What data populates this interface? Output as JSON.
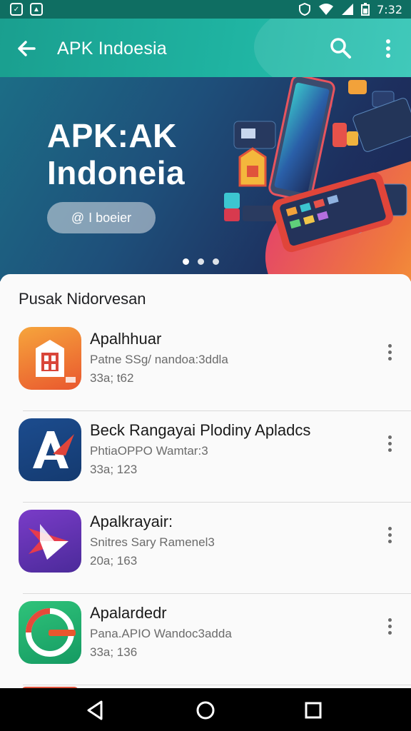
{
  "status_bar": {
    "time": "7:32"
  },
  "app_bar": {
    "title": "APK Indoesia"
  },
  "banner": {
    "title": "APK:AK Indoneia",
    "button_label": "I boeier",
    "button_glyph": "@"
  },
  "list": {
    "section_title": "Pusak Nidorvesan",
    "apps": [
      {
        "name": "Apalhhuar",
        "subtitle": "Patne SSg/ nandoa:3ddla",
        "meta": "33a; t62"
      },
      {
        "name": "Beck Rangayai Plodiny Apladcs",
        "subtitle": "PhtiaOPPO Wamtar:3",
        "meta": "33a; 123"
      },
      {
        "name": "Apalkrayair:",
        "subtitle": "Snitres Sary Ramenel3",
        "meta": "20a; 163"
      },
      {
        "name": "Apalardedr",
        "subtitle": "Pana.APIO Wandoc3adda",
        "meta": "33a; 136"
      }
    ]
  },
  "icons": {
    "back": "arrow-left-icon",
    "search": "search-icon",
    "more": "more-vertical-icon",
    "nav_back": "nav-back-triangle-icon",
    "nav_home": "nav-home-circle-icon",
    "nav_recents": "nav-recents-square-icon"
  },
  "colors": {
    "status_bar": "#0f6e62",
    "app_bar": "#1fb3a1",
    "banner": "#1e4f7a",
    "card": "#fafafa",
    "nav_bar": "#000000"
  }
}
